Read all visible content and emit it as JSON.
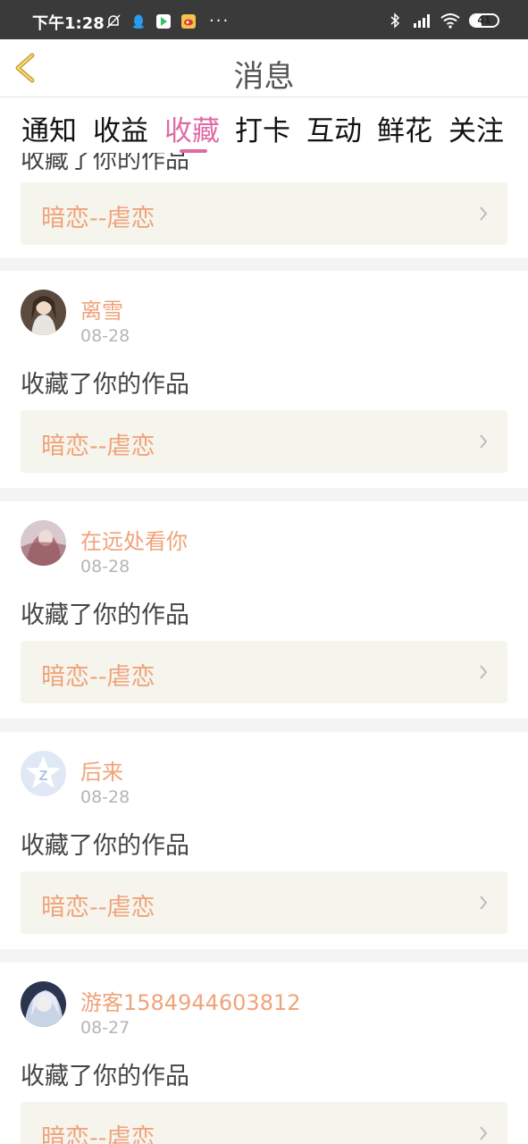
{
  "status_bar": {
    "time": "下午1:28",
    "battery": "41",
    "battery_level": 0.41
  },
  "header": {
    "title": "消息"
  },
  "tabs": [
    {
      "label": "通知",
      "active": false
    },
    {
      "label": "收益",
      "active": false
    },
    {
      "label": "收藏",
      "active": true
    },
    {
      "label": "打卡",
      "active": false
    },
    {
      "label": "互动",
      "active": false
    },
    {
      "label": "鲜花",
      "active": false
    },
    {
      "label": "关注",
      "active": false
    }
  ],
  "partial_entry": {
    "action": "收藏了你的作品",
    "work_title": "暗恋--虐恋"
  },
  "entries": [
    {
      "username": "离雪",
      "date": "08-28",
      "action": "收藏了你的作品",
      "work_title": "暗恋--虐恋"
    },
    {
      "username": "在远处看你",
      "date": "08-28",
      "action": "收藏了你的作品",
      "work_title": "暗恋--虐恋"
    },
    {
      "username": "后来",
      "date": "08-28",
      "action": "收藏了你的作品",
      "work_title": "暗恋--虐恋"
    },
    {
      "username": "游客1584944603812",
      "date": "08-27",
      "action": "收藏了你的作品",
      "work_title": "暗恋--虐恋"
    }
  ],
  "colors": {
    "accent": "#e06aa5",
    "username": "#f0a37a",
    "card_bg": "#f5f5ee"
  }
}
